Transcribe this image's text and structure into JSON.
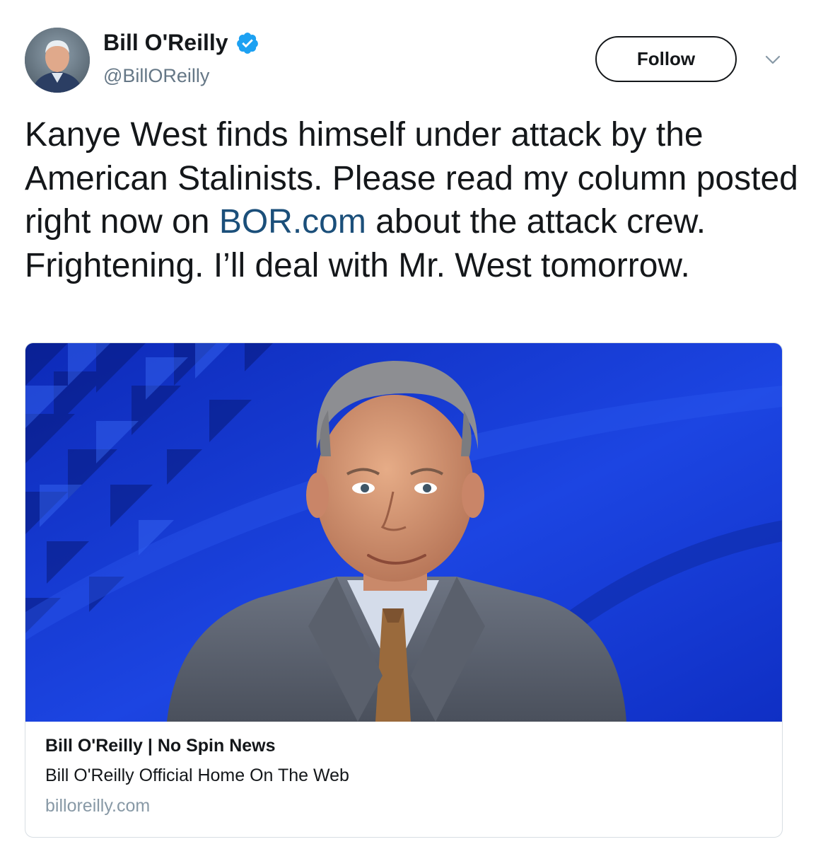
{
  "author": {
    "display_name": "Bill O'Reilly",
    "handle": "@BillOReilly",
    "verified": true,
    "verified_color": "#1da1f2"
  },
  "actions": {
    "follow_label": "Follow",
    "menu_icon": "chevron-down-icon"
  },
  "tweet": {
    "text_before_link": "Kanye West finds himself under attack by the American Stalinists. Please read my column posted right now on ",
    "link_text": "BOR.com",
    "text_after_link": " about the attack crew. Frightening. I’ll deal with Mr. West tomorrow.",
    "link_color": "#1b4f7a"
  },
  "card": {
    "title": "Bill O'Reilly | No Spin News",
    "description": "Bill O'Reilly Official Home On The Web",
    "domain": "billoreilly.com",
    "image_background": "#1a3fd0"
  }
}
